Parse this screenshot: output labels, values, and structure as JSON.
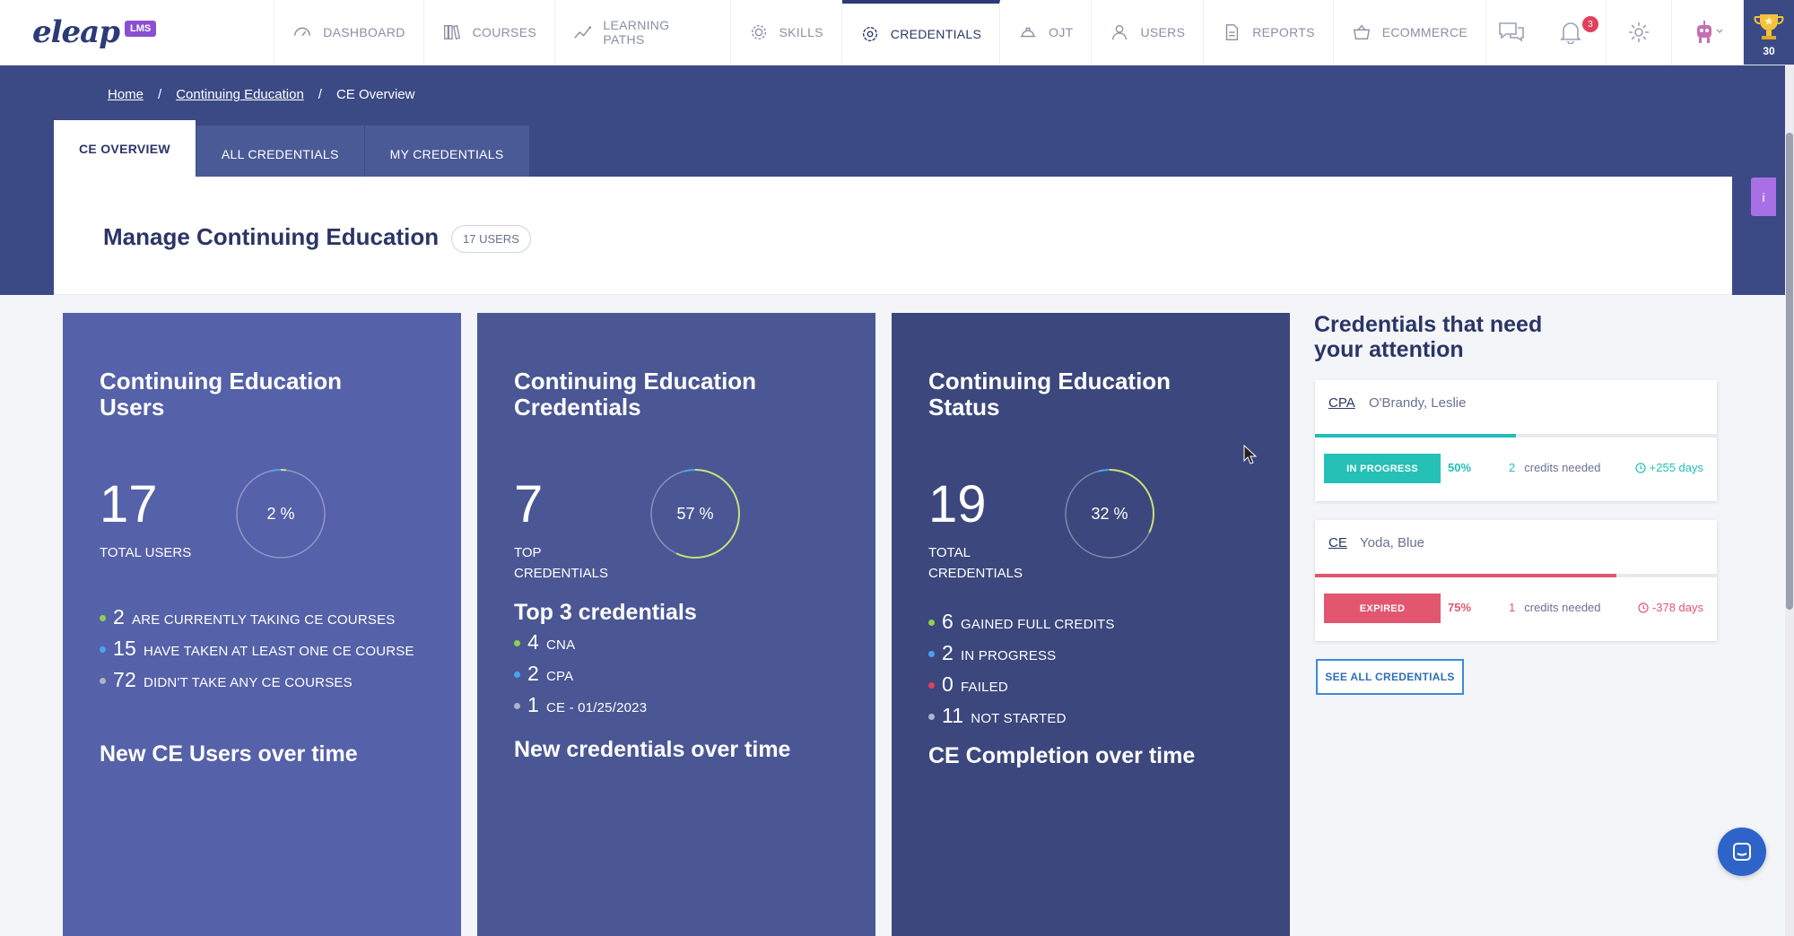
{
  "app": {
    "logo_text": "eleap",
    "logo_badge": "LMS"
  },
  "nav": {
    "items": [
      {
        "label": "DASHBOARD",
        "icon": "gauge-icon"
      },
      {
        "label": "COURSES",
        "icon": "books-icon"
      },
      {
        "label": "LEARNING PATHS",
        "icon": "path-icon"
      },
      {
        "label": "SKILLS",
        "icon": "gear-icon"
      },
      {
        "label": "CREDENTIALS",
        "icon": "badge-icon",
        "active": true
      },
      {
        "label": "OJT",
        "icon": "hardhat-icon"
      },
      {
        "label": "USERS",
        "icon": "user-icon"
      },
      {
        "label": "REPORTS",
        "icon": "report-icon"
      },
      {
        "label": "ECOMMERCE",
        "icon": "basket-icon"
      }
    ],
    "notifications_count": "3",
    "trophy_points": "30"
  },
  "breadcrumb": {
    "home": "Home",
    "section": "Continuing Education",
    "current": "CE Overview",
    "separator": "/"
  },
  "tabs": [
    {
      "label": "CE OVERVIEW",
      "active": true
    },
    {
      "label": "ALL CREDENTIALS"
    },
    {
      "label": "MY CREDENTIALS"
    }
  ],
  "page": {
    "title": "Manage Continuing Education",
    "users_pill": "17 USERS",
    "side_tab": "i"
  },
  "cards": {
    "users": {
      "title": "Continuing Education Users",
      "value": "17",
      "value_label": "TOTAL USERS",
      "ring_percent": 2,
      "ring_text": "2 %",
      "stats": [
        {
          "num": "2",
          "text": "ARE CURRENTLY TAKING CE COURSES",
          "color": "#8fd14f"
        },
        {
          "num": "15",
          "text": "HAVE TAKEN AT LEAST ONE CE COURSE",
          "color": "#4aa3f0"
        },
        {
          "num": "72",
          "text": "DIDN'T TAKE ANY CE COURSES",
          "color": "#aeb4c8"
        }
      ],
      "subtitle": "New CE Users over time",
      "bg": "#5561a8"
    },
    "credentials": {
      "title": "Continuing Education Credentials",
      "value": "7",
      "value_label": "TOP CREDENTIALS",
      "ring_percent": 57,
      "ring_text": "57 %",
      "top_title": "Top 3 credentials",
      "stats": [
        {
          "num": "4",
          "text": "CNA",
          "color": "#8fd14f"
        },
        {
          "num": "2",
          "text": "CPA",
          "color": "#4aa3f0"
        },
        {
          "num": "1",
          "text": "CE - 01/25/2023",
          "color": "#aeb4c8"
        }
      ],
      "subtitle": "New credentials over time",
      "bg": "#4a5794"
    },
    "status": {
      "title": "Continuing Education Status",
      "value": "19",
      "value_label": "TOTAL CREDENTIALS",
      "ring_percent": 32,
      "ring_text": "32 %",
      "stats": [
        {
          "num": "6",
          "text": "GAINED FULL CREDITS",
          "color": "#8fd14f"
        },
        {
          "num": "2",
          "text": "IN PROGRESS",
          "color": "#4aa3f0"
        },
        {
          "num": "0",
          "text": "FAILED",
          "color": "#e2405b"
        },
        {
          "num": "11",
          "text": "NOT STARTED",
          "color": "#aeb4c8"
        }
      ],
      "subtitle": "CE Completion over time",
      "bg": "#3c477d"
    }
  },
  "attention": {
    "title": "Credentials that need your attention",
    "items": [
      {
        "code": "CPA",
        "name": "O'Brandy, Leslie",
        "status": "IN PROGRESS",
        "percent": "50%",
        "progress": 0.5,
        "credits_num": "2",
        "credits_text": "credits needed",
        "days": "+255 days",
        "color": "#1fbfb8",
        "status_color": "#25c0b6"
      },
      {
        "code": "CE",
        "name": "Yoda, Blue",
        "status": "EXPIRED",
        "percent": "75%",
        "progress": 0.75,
        "credits_num": "1",
        "credits_text": "credits needed",
        "days": "-378 days",
        "color": "#e2566f",
        "status_color": "#e2566f"
      }
    ],
    "see_all": "SEE ALL CREDENTIALS"
  }
}
